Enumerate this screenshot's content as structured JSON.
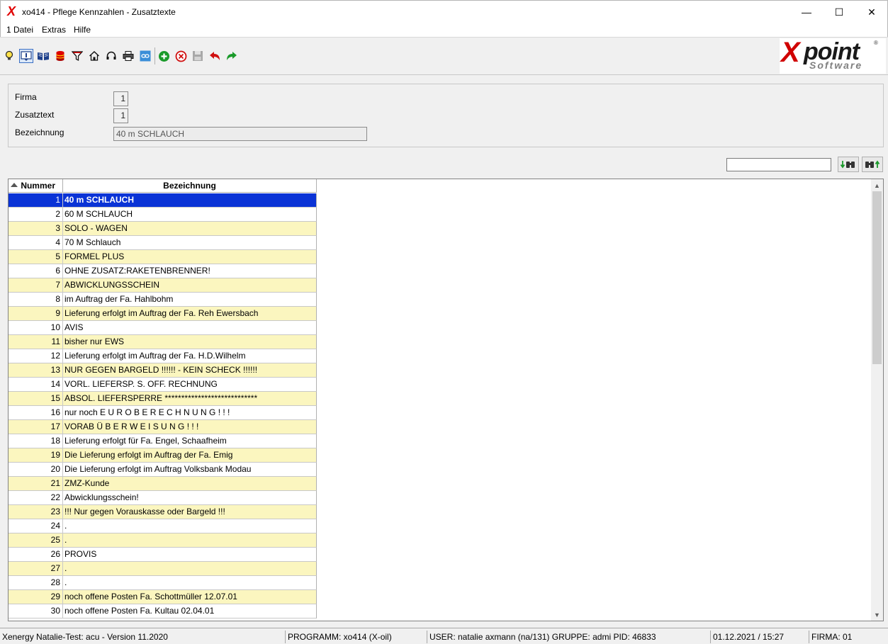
{
  "window": {
    "title": "xo414 - Pflege Kennzahlen - Zusatztexte",
    "minimize_glyph": "—",
    "maximize_glyph": "☐",
    "close_glyph": "✕"
  },
  "menu": {
    "items": [
      "1 Datei",
      "Extras",
      "Hilfe"
    ]
  },
  "toolbar": {
    "icons": [
      "lightbulb-icon",
      "info-icon",
      "book-icon",
      "database-icon",
      "filter-icon",
      "home-icon",
      "headset-icon",
      "print-icon",
      "link-icon",
      "add-icon",
      "delete-icon",
      "save-icon",
      "undo-icon",
      "redo-icon"
    ],
    "colors": {
      "add": "#1a9a2a",
      "delete": "#d01010",
      "undo": "#d01010",
      "redo": "#1a9a2a"
    }
  },
  "brand": {
    "logo_x": "X",
    "logo_point": "point",
    "logo_software": "Software",
    "logo_reg": "®"
  },
  "form": {
    "firma_label": "Firma",
    "firma_value": "1",
    "zusatztext_label": "Zusatztext",
    "zusatztext_value": "1",
    "bezeichnung_label": "Bezeichnung",
    "bezeichnung_value": "40 m SCHLAUCH"
  },
  "search": {
    "value": "",
    "find_next_label": "▼⧉",
    "find_prev_label": "⧉▲"
  },
  "grid": {
    "columns": {
      "number": "Nummer",
      "description": "Bezeichnung"
    },
    "selected_row": 1,
    "rows": [
      {
        "num": "1",
        "text": "40 m SCHLAUCH"
      },
      {
        "num": "2",
        "text": "60 M SCHLAUCH"
      },
      {
        "num": "3",
        "text": "SOLO - WAGEN"
      },
      {
        "num": "4",
        "text": "70 M Schlauch"
      },
      {
        "num": "5",
        "text": "FORMEL PLUS"
      },
      {
        "num": "6",
        "text": "OHNE ZUSATZ:RAKETENBRENNER!"
      },
      {
        "num": "7",
        "text": "ABWICKLUNGSSCHEIN"
      },
      {
        "num": "8",
        "text": "im Auftrag der Fa. Hahlbohm"
      },
      {
        "num": "9",
        "text": "Lieferung erfolgt im Auftrag der Fa. Reh Ewersbach"
      },
      {
        "num": "10",
        "text": "AVIS"
      },
      {
        "num": "11",
        "text": "bisher nur EWS"
      },
      {
        "num": "12",
        "text": "Lieferung erfolgt im Auftrag der Fa. H.D.Wilhelm"
      },
      {
        "num": "13",
        "text": "NUR GEGEN BARGELD !!!!!! - KEIN SCHECK !!!!!!"
      },
      {
        "num": "14",
        "text": "VORL. LIEFERSP. S. OFF. RECHNUNG"
      },
      {
        "num": "15",
        "text": "ABSOL. LIEFERSPERRE ****************************"
      },
      {
        "num": "16",
        "text": "nur noch E U R O B E R E C H N U N G ! ! !"
      },
      {
        "num": "17",
        "text": "VORAB Ü B E R W E I S U N G ! ! !"
      },
      {
        "num": "18",
        "text": "Lieferung erfolgt für Fa. Engel, Schaafheim"
      },
      {
        "num": "19",
        "text": "Die Lieferung erfolgt im Auftrag der Fa. Emig"
      },
      {
        "num": "20",
        "text": "Die Lieferung erfolgt im Auftrag Volksbank Modau"
      },
      {
        "num": "21",
        "text": "ZMZ-Kunde"
      },
      {
        "num": "22",
        "text": "Abwicklungsschein!"
      },
      {
        "num": "23",
        "text": "!!! Nur gegen Vorauskasse oder Bargeld !!!"
      },
      {
        "num": "24",
        "text": "."
      },
      {
        "num": "25",
        "text": "."
      },
      {
        "num": "26",
        "text": "PROVIS"
      },
      {
        "num": "27",
        "text": "."
      },
      {
        "num": "28",
        "text": "."
      },
      {
        "num": "29",
        "text": "noch offene Posten Fa. Schottmüller 12.07.01"
      },
      {
        "num": "30",
        "text": "noch offene Posten Fa. Kultau 02.04.01"
      }
    ]
  },
  "scrollbar": {
    "up_glyph": "▲",
    "down_glyph": "▼"
  },
  "status": {
    "system": "Xenergy Natalie-Test: acu - Version 11.2020",
    "program": "PROGRAMM: xo414 (X-oil)",
    "user": "USER: natalie axmann (na/131)  GRUPPE: admi  PID: 46833",
    "datetime": "01.12.2021 / 15:27",
    "firma": "FIRMA: 01"
  }
}
